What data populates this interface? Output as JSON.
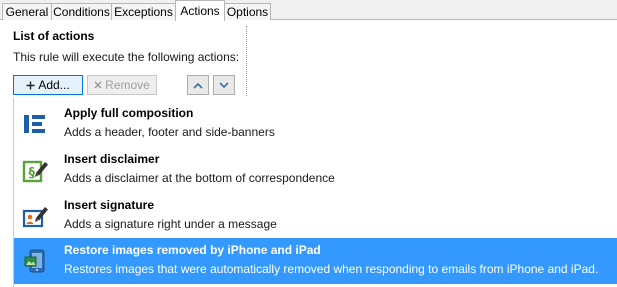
{
  "tabs": [
    {
      "label": "General"
    },
    {
      "label": "Conditions"
    },
    {
      "label": "Exceptions"
    },
    {
      "label": "Actions",
      "active": true
    },
    {
      "label": "Options"
    }
  ],
  "section": {
    "title": "List of actions",
    "subtitle": "This rule will execute the following actions:"
  },
  "toolbar": {
    "add_label": "Add...",
    "remove_label": "Remove"
  },
  "actions": [
    {
      "title": "Apply full composition",
      "description": "Adds a header, footer and side-banners",
      "icon": "composition-icon"
    },
    {
      "title": "Insert disclaimer",
      "description": "Adds a disclaimer at the bottom of correspondence",
      "icon": "disclaimer-icon"
    },
    {
      "title": "Insert signature",
      "description": "Adds a signature right under a message",
      "icon": "signature-icon"
    },
    {
      "title": "Restore images removed by iPhone and iPad",
      "description": "Restores images that were automatically removed when responding to emails from iPhone and iPad.",
      "icon": "restore-images-icon",
      "selected": true
    }
  ],
  "colors": {
    "selection": "#3399ff",
    "icon_blue": "#1f5ea8",
    "icon_green": "#5aa23a",
    "icon_orange": "#e26b1d"
  }
}
